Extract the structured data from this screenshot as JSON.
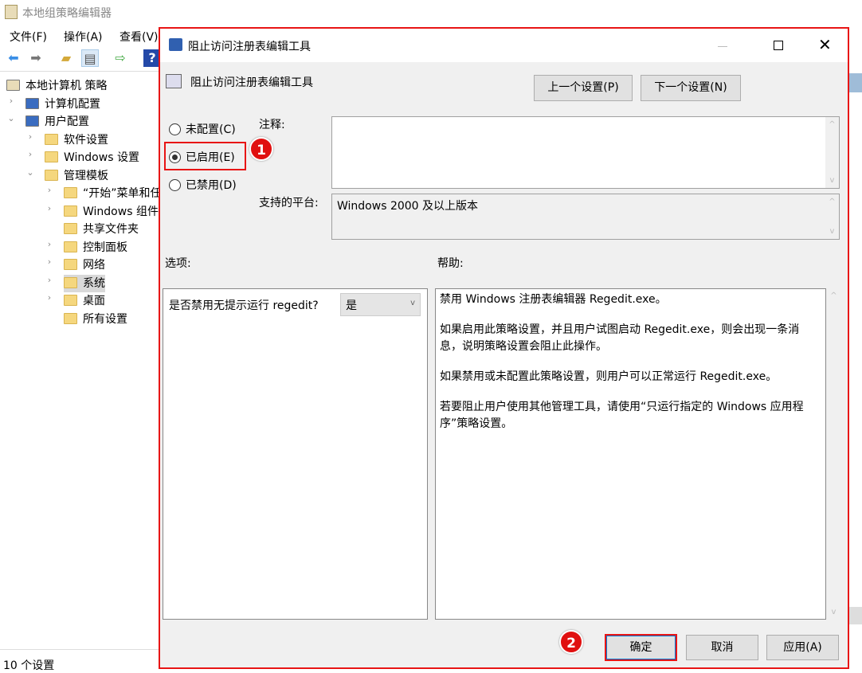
{
  "app": {
    "title": "本地组策略编辑器",
    "menu": [
      "文件(F)",
      "操作(A)",
      "查看(V)"
    ]
  },
  "tree": [
    {
      "label": "本地计算机 策略",
      "level": 0,
      "chevron": ""
    },
    {
      "label": "计算机配置",
      "level": 1,
      "chevron": ">"
    },
    {
      "label": "用户配置",
      "level": 1,
      "chevron": "v"
    },
    {
      "label": "软件设置",
      "level": 2,
      "chevron": ">"
    },
    {
      "label": "Windows 设置",
      "level": 2,
      "chevron": ">"
    },
    {
      "label": "管理模板",
      "level": 2,
      "chevron": "v"
    },
    {
      "label": "“开始”菜单和任",
      "level": 3,
      "chevron": ">"
    },
    {
      "label": "Windows 组件",
      "level": 3,
      "chevron": ">"
    },
    {
      "label": "共享文件夹",
      "level": 3,
      "chevron": ""
    },
    {
      "label": "控制面板",
      "level": 3,
      "chevron": ">"
    },
    {
      "label": "网络",
      "level": 3,
      "chevron": ">"
    },
    {
      "label": "系统",
      "level": 3,
      "chevron": ">",
      "selected": true
    },
    {
      "label": "桌面",
      "level": 3,
      "chevron": ">"
    },
    {
      "label": "所有设置",
      "level": 3,
      "chevron": ""
    }
  ],
  "status": "10 个设置",
  "dialog": {
    "title": "阻止访问注册表编辑工具",
    "heading": "阻止访问注册表编辑工具",
    "prev": "上一个设置(P)",
    "next": "下一个设置(N)",
    "radios": [
      "未配置(C)",
      "已启用(E)",
      "已禁用(D)"
    ],
    "selected_radio": 1,
    "comment_label": "注释:",
    "comment_value": "",
    "platform_label": "支持的平台:",
    "platform_value": "Windows 2000 及以上版本",
    "options_label": "选项:",
    "help_label": "帮助:",
    "option_prompt": "是否禁用无提示运行 regedit?",
    "option_value": "是",
    "help": [
      "禁用 Windows 注册表编辑器 Regedit.exe。",
      "如果启用此策略设置，并且用户试图启动 Regedit.exe，则会出现一条消息，说明策略设置会阻止此操作。",
      "如果禁用或未配置此策略设置，则用户可以正常运行 Regedit.exe。",
      "若要阻止用户使用其他管理工具，请使用“只运行指定的 Windows 应用程序”策略设置。"
    ],
    "ok": "确定",
    "cancel": "取消",
    "apply": "应用(A)"
  },
  "annotations": {
    "step1": "1",
    "step2": "2",
    "highlight_color": "#e81515"
  }
}
